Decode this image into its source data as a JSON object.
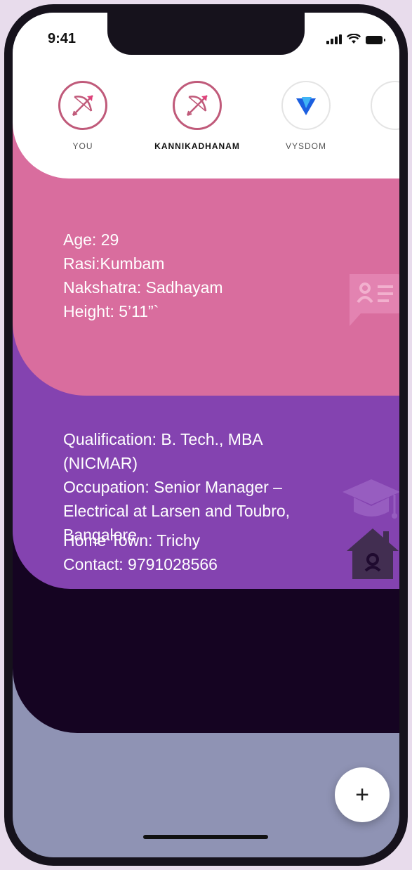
{
  "status": {
    "time": "9:41"
  },
  "stories": [
    {
      "label": "YOU",
      "icon": "bow-arrow-icon"
    },
    {
      "label": "KANNIKADHANAM",
      "icon": "bow-arrow-icon"
    },
    {
      "label": "VYSDOM",
      "icon": "vysdom-logo-icon"
    }
  ],
  "cards": {
    "personal": {
      "lines": [
        "Age: 29",
        "Rasi:Kumbam",
        "Nakshatra: Sadhayam",
        "Height: 5’11”`"
      ],
      "icon": "profile-card-icon"
    },
    "career": {
      "lines": [
        "Qualification: B. Tech., MBA",
        "(NICMAR)",
        "Occupation: Senior Manager –",
        "Electrical at Larsen and Toubro,",
        "Bangalore"
      ],
      "icon": "graduation-cap-icon"
    },
    "contact": {
      "lines": [
        "Home Town: Trichy",
        "Contact: 9791028566"
      ],
      "icon": "home-icon"
    }
  },
  "fab": {
    "label": "+"
  },
  "colors": {
    "pink": "#d96d9e",
    "purple": "#8443b0",
    "dark": "#150422",
    "lavender": "#8f93b4"
  }
}
